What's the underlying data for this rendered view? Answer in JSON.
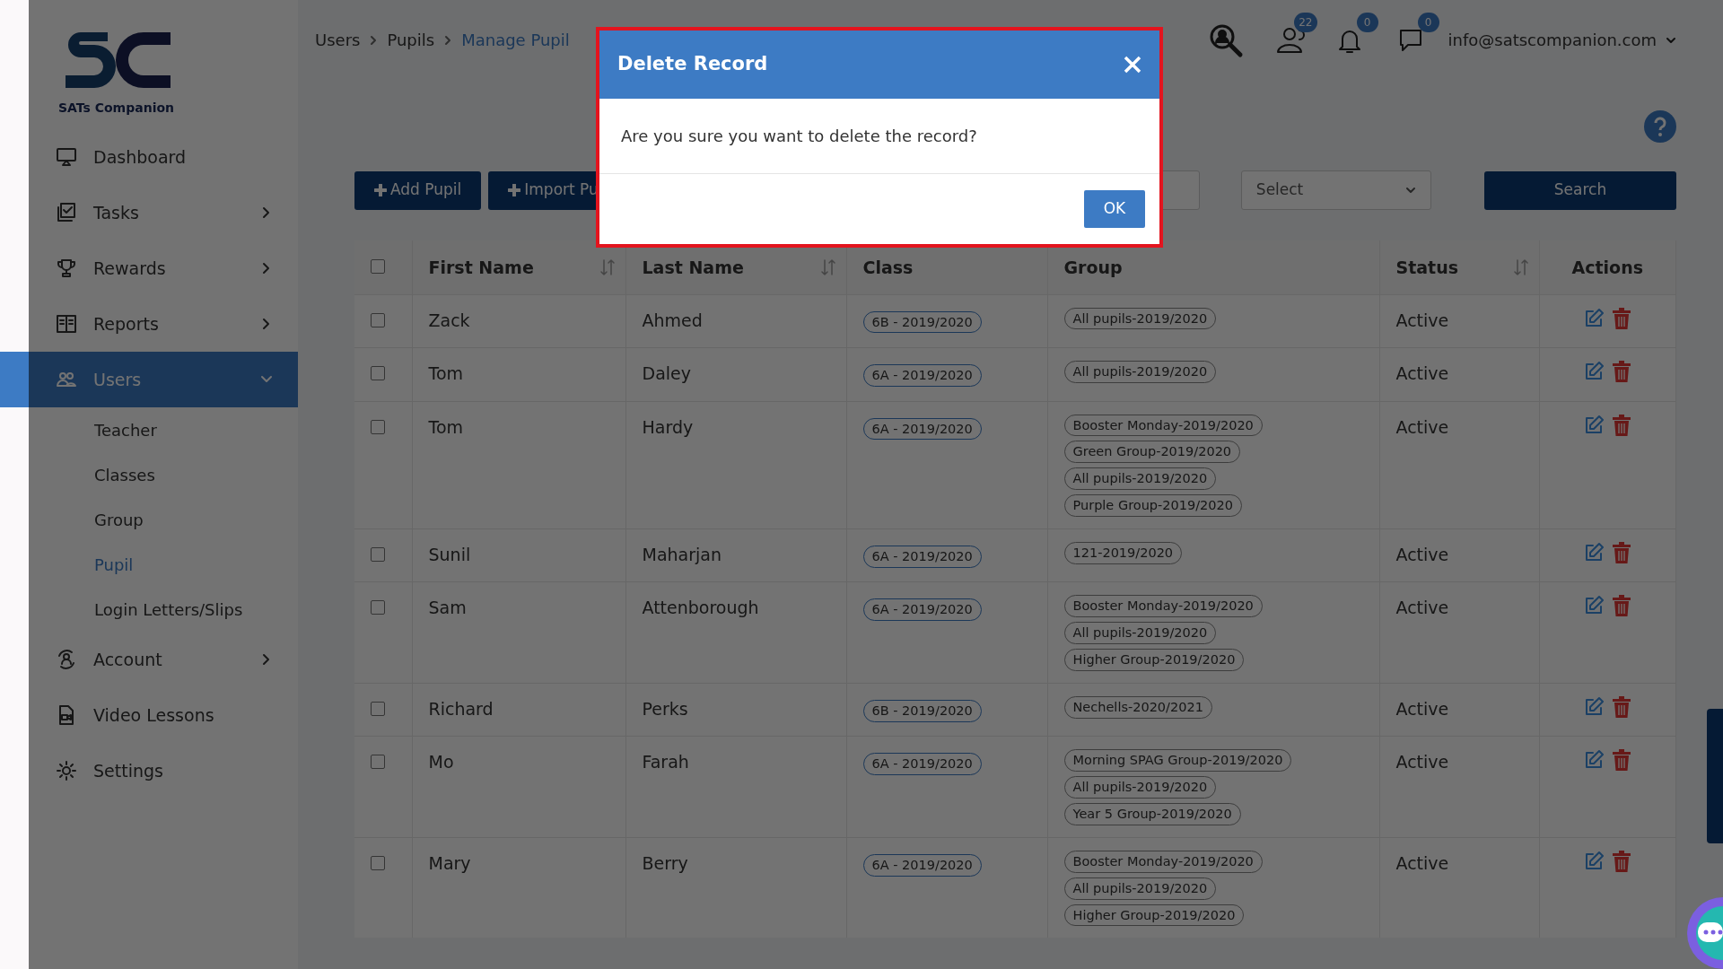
{
  "logo": {
    "text": "SATs Companion"
  },
  "sidebar": {
    "items": [
      {
        "label": "Dashboard",
        "selected": false
      },
      {
        "label": "Tasks",
        "expanded": false,
        "selected": false
      },
      {
        "label": "Rewards",
        "expanded": false,
        "selected": false
      },
      {
        "label": "Reports",
        "expanded": false,
        "selected": false
      },
      {
        "label": "Users",
        "expanded": true,
        "selected": true,
        "children": [
          {
            "label": "Teacher",
            "selected": false
          },
          {
            "label": "Classes",
            "selected": false
          },
          {
            "label": "Group",
            "selected": false
          },
          {
            "label": "Pupil",
            "selected": true
          },
          {
            "label": "Login Letters/Slips",
            "selected": false
          }
        ]
      },
      {
        "label": "Account",
        "expanded": false,
        "selected": false
      },
      {
        "label": "Video Lessons",
        "selected": false
      },
      {
        "label": "Settings",
        "selected": false
      }
    ]
  },
  "header": {
    "breadcrumb": [
      "Users",
      "Pupils",
      "Manage Pupil"
    ],
    "badges": [
      "22",
      "0",
      "0"
    ],
    "user": "info@satscompanion.com"
  },
  "toolbar": {
    "buttons": [
      "Add Pupil",
      "Import Pu"
    ],
    "select": "Select",
    "search_button": "Search"
  },
  "table": {
    "all_selected": false,
    "columns": [
      {
        "label": "First Name",
        "sortable": true
      },
      {
        "label": "Last Name",
        "sortable": true
      },
      {
        "label": "Class",
        "sortable": false
      },
      {
        "label": "Group",
        "sortable": false
      },
      {
        "label": "Status",
        "sortable": true
      },
      {
        "label": "Actions",
        "sortable": false
      }
    ],
    "rows": [
      {
        "selected": false,
        "first": "Zack",
        "last": "Ahmed",
        "class": "6B - 2019/2020",
        "groups": [
          "All pupils-2019/2020"
        ],
        "status": "Active"
      },
      {
        "selected": false,
        "first": "Tom",
        "last": "Daley",
        "class": "6A - 2019/2020",
        "groups": [
          "All pupils-2019/2020"
        ],
        "status": "Active"
      },
      {
        "selected": false,
        "first": "Tom",
        "last": "Hardy",
        "class": "6A - 2019/2020",
        "groups": [
          "Booster Monday-2019/2020",
          "Green Group-2019/2020",
          "All pupils-2019/2020",
          "Purple Group-2019/2020"
        ],
        "status": "Active"
      },
      {
        "selected": false,
        "first": "Sunil",
        "last": "Maharjan",
        "class": "6A - 2019/2020",
        "groups": [
          "121-2019/2020"
        ],
        "status": "Active"
      },
      {
        "selected": false,
        "first": "Sam",
        "last": "Attenborough",
        "class": "6A - 2019/2020",
        "groups": [
          "Booster Monday-2019/2020",
          "All pupils-2019/2020",
          "Higher Group-2019/2020"
        ],
        "status": "Active"
      },
      {
        "selected": false,
        "first": "Richard",
        "last": "Perks",
        "class": "6B - 2019/2020",
        "groups": [
          "Nechells-2020/2021"
        ],
        "status": "Active"
      },
      {
        "selected": false,
        "first": "Mo",
        "last": "Farah",
        "class": "6A - 2019/2020",
        "groups": [
          "Morning SPAG Group-2019/2020",
          "All pupils-2019/2020",
          "Year 5 Group-2019/2020"
        ],
        "status": "Active"
      },
      {
        "selected": false,
        "first": "Mary",
        "last": "Berry",
        "class": "6A - 2019/2020",
        "groups": [
          "Booster Monday-2019/2020",
          "All pupils-2019/2020",
          "Higher Group-2019/2020"
        ],
        "status": "Active"
      }
    ]
  },
  "modal": {
    "title": "Delete Record",
    "message": "Are you sure you want to delete the record?",
    "ok": "OK"
  }
}
